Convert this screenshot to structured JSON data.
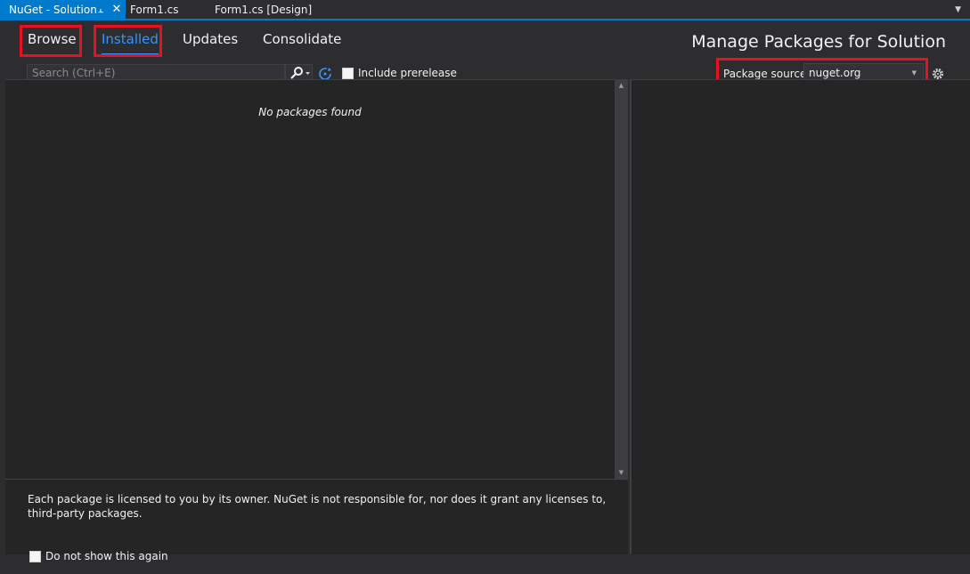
{
  "document_tabs": [
    {
      "label": "NuGet - Solution",
      "active": true
    },
    {
      "label": "Form1.cs",
      "active": false
    },
    {
      "label": "Form1.cs [Design]",
      "active": false
    }
  ],
  "nuget_tabs": [
    {
      "label": "Browse",
      "active": false
    },
    {
      "label": "Installed",
      "active": true
    },
    {
      "label": "Updates",
      "active": false
    },
    {
      "label": "Consolidate",
      "active": false
    }
  ],
  "header": {
    "title": "Manage Packages for Solution"
  },
  "search": {
    "placeholder": "Search (Ctrl+E)",
    "value": ""
  },
  "include_prerelease": {
    "label": "Include prerelease",
    "checked": false
  },
  "package_source": {
    "label": "Package source:",
    "selected": "nuget.org"
  },
  "package_list": {
    "empty_message": "No packages found"
  },
  "footer": {
    "license_text": "Each package is licensed to you by its owner. NuGet is not responsible for, nor does it grant any licenses to, third-party packages.",
    "do_not_show": {
      "label": "Do not show this again",
      "checked": false
    }
  },
  "icons": {
    "pin": "pin-icon",
    "close": "close-icon",
    "search": "search-icon",
    "refresh": "refresh-icon",
    "settings": "gear-icon",
    "dropdown": "chevron-down-icon"
  },
  "colors": {
    "accent": "#007acc",
    "active_tab_text": "#3794ff",
    "highlight_box": "#e81123",
    "background": "#2d2d30",
    "pane_background": "#252526"
  }
}
